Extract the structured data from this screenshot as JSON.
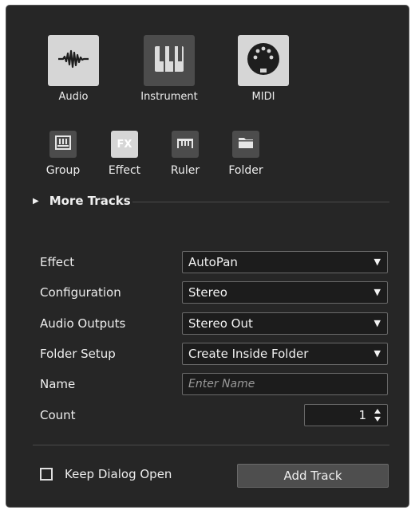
{
  "track_types": [
    {
      "label": "Audio",
      "icon": "waveform-icon",
      "selected": true
    },
    {
      "label": "Instrument",
      "icon": "piano-keys-icon",
      "selected": false
    },
    {
      "label": "MIDI",
      "icon": "midi-port-icon",
      "selected": true
    }
  ],
  "track_types_small": [
    {
      "label": "Group",
      "icon": "group-fader-icon",
      "selected": false
    },
    {
      "label": "Effect",
      "icon": "fx-icon",
      "icon_text": "FX",
      "selected": true
    },
    {
      "label": "Ruler",
      "icon": "ruler-icon",
      "selected": false
    },
    {
      "label": "Folder",
      "icon": "folder-icon",
      "selected": false
    }
  ],
  "more_tracks": {
    "label": "More Tracks",
    "arrow": "▶"
  },
  "form": {
    "effect": {
      "label": "Effect",
      "value": "AutoPan"
    },
    "configuration": {
      "label": "Configuration",
      "value": "Stereo"
    },
    "audio_outputs": {
      "label": "Audio Outputs",
      "value": "Stereo Out"
    },
    "folder_setup": {
      "label": "Folder Setup",
      "value": "Create Inside Folder"
    },
    "name": {
      "label": "Name",
      "placeholder": "Enter Name",
      "value": ""
    },
    "count": {
      "label": "Count",
      "value": "1"
    },
    "dropdown_arrow": "▼"
  },
  "footer": {
    "keep_open": {
      "label": "Keep Dialog Open",
      "checked": false
    },
    "add_track": {
      "label": "Add Track"
    }
  },
  "colors": {
    "background": "#262626",
    "tile": "#4c4c4c",
    "tile_selected": "#d6d6d6",
    "field": "#1c1c1c",
    "button": "#4e4e4e"
  }
}
